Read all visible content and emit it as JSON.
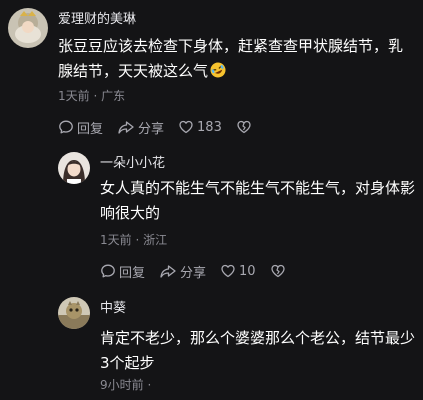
{
  "comments": [
    {
      "username": "爱理财的美琳",
      "content": "张豆豆应该去检查下身体，赶紧查查甲状腺结节，乳腺结节，天天被这么气",
      "emoji": "rofl-emoji",
      "time": "1天前",
      "separator": "·",
      "location": "广东",
      "reply_label": "回复",
      "share_label": "分享",
      "like_count": "183"
    },
    {
      "username": "一朵小小花",
      "content": "女人真的不能生气不能生气不能生气，对身体影响很大的",
      "time": "1天前",
      "separator": "·",
      "location": "浙江",
      "reply_label": "回复",
      "share_label": "分享",
      "like_count": "10"
    },
    {
      "username": "中葵",
      "content": "肯定不老少，那么个婆婆那么个老公，结节最少3个起步",
      "time": "9小时前",
      "separator": "·"
    }
  ],
  "colors": {
    "background": "#141416",
    "meta_text": "#8a8a92",
    "action_text": "#a8a8b0"
  }
}
